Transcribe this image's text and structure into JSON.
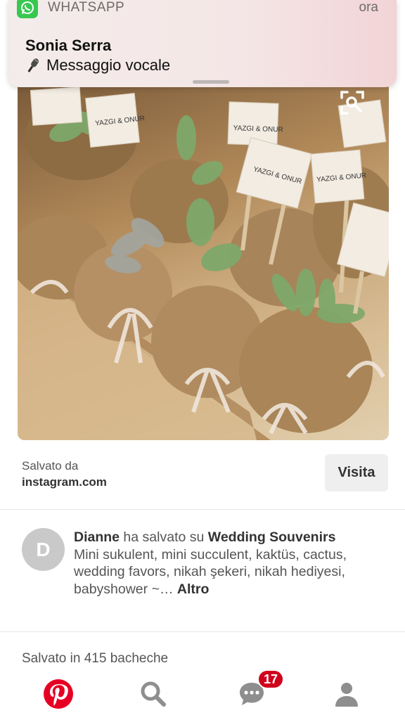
{
  "notification": {
    "app_name": "WHATSAPP",
    "time": "ora",
    "sender": "Sonia Serra",
    "message": "Messaggio vocale",
    "icon": "whatsapp-icon",
    "message_icon": "microphone-icon"
  },
  "pin": {
    "image_icon": "visual-search-icon",
    "tag_text": "YAZGI & ONUR"
  },
  "source": {
    "saved_from_label": "Salvato da",
    "domain": "instagram.com",
    "visit_label": "Visita"
  },
  "saver": {
    "avatar_letter": "D",
    "name": "Dianne",
    "action": " ha salvato su ",
    "board": "Wedding Souvenirs",
    "description": "Mini sukulent, mini succulent, kaktüs, cactus, wedding favors, nikah şekeri, nikah hediyesi, babyshower ~… ",
    "more_label": "Altro"
  },
  "stats": {
    "saved_count_text": "Salvato in 415 bacheche"
  },
  "nav": {
    "items": [
      {
        "icon": "pinterest-home-icon",
        "active": true
      },
      {
        "icon": "search-icon",
        "active": false
      },
      {
        "icon": "messages-icon",
        "active": false,
        "badge": "17"
      },
      {
        "icon": "profile-icon",
        "active": false
      }
    ]
  },
  "colors": {
    "pinterest_red": "#e60023",
    "badge_red": "#d0021b",
    "nav_gray": "#8e8e8e",
    "whatsapp_green": "#37c84f"
  }
}
